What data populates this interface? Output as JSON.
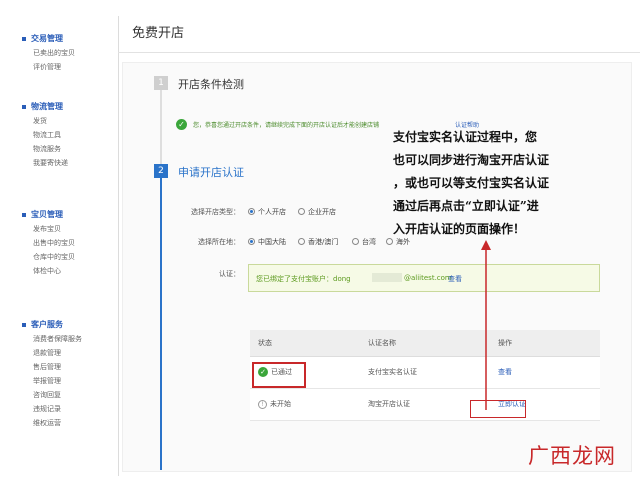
{
  "sidebar": {
    "sections": [
      {
        "title": "交易管理",
        "items": [
          "已卖出的宝贝",
          "评价管理"
        ]
      },
      {
        "title": "物流管理",
        "items": [
          "发货",
          "物流工具",
          "物流服务",
          "我要寄快递"
        ]
      },
      {
        "title": "宝贝管理",
        "items": [
          "发布宝贝",
          "出售中的宝贝",
          "仓库中的宝贝",
          "体检中心"
        ]
      },
      {
        "title": "客户服务",
        "items": [
          "消费者保障服务",
          "退款管理",
          "售后管理",
          "举报管理",
          "咨询回复",
          "违规记录",
          "维权运营"
        ]
      }
    ]
  },
  "page": {
    "title": "免费开店"
  },
  "step1": {
    "num": "1",
    "title": "开店条件检测",
    "ok_text": "您，恭喜您通过开店条件，请继续完成下面的开店认证后才能创建店铺",
    "ok_link": "认证帮助"
  },
  "step2": {
    "num": "2",
    "title": "申请开店认证",
    "type_label": "选择开店类型：",
    "type_options": [
      "个人开店",
      "企业开店"
    ],
    "region_label": "选择所在地：",
    "region_options": [
      "中国大陆",
      "香港/澳门",
      "台湾",
      "海外"
    ],
    "auth_label": "认证：",
    "auth_text": "您已绑定了支付宝账户：dong",
    "auth_email": "@aliitest.com",
    "auth_link": "查看"
  },
  "table": {
    "headers": [
      "状态",
      "认证名称",
      "操作"
    ],
    "rows": [
      {
        "status": "已通过",
        "name": "支付宝实名认证",
        "action": "查看"
      },
      {
        "status": "未开始",
        "name": "淘宝开店认证",
        "action": "立即认证"
      }
    ]
  },
  "callout": {
    "lines": [
      "支付宝实名认证过程中，您",
      "也可以同步进行淘宝开店认证",
      "，或也可以等支付宝实名认证",
      "通过后再点击“立即认证”进",
      "入开店认证的页面操作！"
    ]
  },
  "watermark": "广西龙网",
  "colors": {
    "accent": "#2a73c9",
    "annotation": "#c8282a",
    "success": "#3aa63a"
  }
}
